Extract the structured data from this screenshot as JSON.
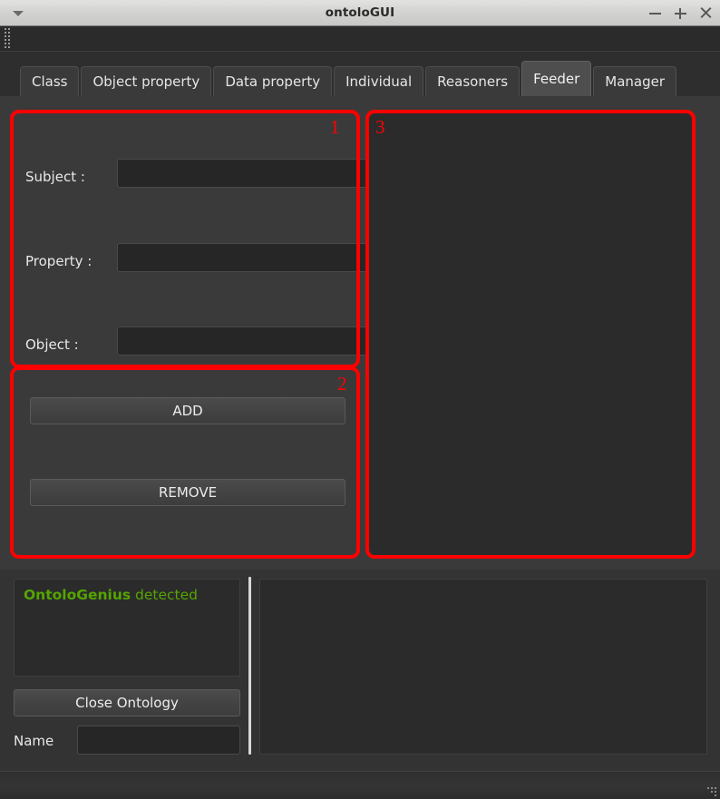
{
  "window": {
    "title": "ontoloGUI",
    "menu_icon": "chevron-down-icon",
    "minimize_label": "−",
    "maximize_label": "+",
    "close_label": "×"
  },
  "tabs": [
    {
      "label": "Class",
      "active": false
    },
    {
      "label": "Object property",
      "active": false
    },
    {
      "label": "Data property",
      "active": false
    },
    {
      "label": "Individual",
      "active": false
    },
    {
      "label": "Reasoners",
      "active": false
    },
    {
      "label": "Feeder",
      "active": true
    },
    {
      "label": "Manager",
      "active": false
    }
  ],
  "annotations": [
    {
      "number": "1"
    },
    {
      "number": "2"
    },
    {
      "number": "3"
    }
  ],
  "feeder": {
    "fields": [
      {
        "label": "Subject :",
        "value": "",
        "placeholder": ""
      },
      {
        "label": "Property :",
        "value": "",
        "placeholder": ""
      },
      {
        "label": "Object :",
        "value": "",
        "placeholder": ""
      }
    ],
    "actions": {
      "add_label": "ADD",
      "remove_label": "REMOVE"
    }
  },
  "status": {
    "log_strong": "OntoloGenius",
    "log_rest": " detected",
    "log_color": "#55a500",
    "close_ontology_label": "Close Ontology",
    "name_label": "Name",
    "name_value": "",
    "name_placeholder": ""
  }
}
